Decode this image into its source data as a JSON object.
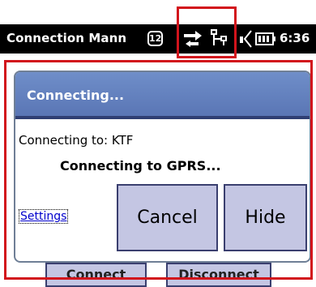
{
  "status_bar": {
    "title": "Connection Mann",
    "badge": "12",
    "clock": "6:36",
    "icons": [
      "badge-icon",
      "data-transfer-icon",
      "network-icon",
      "signal-icon",
      "battery-icon"
    ]
  },
  "dialog": {
    "title": "Connecting...",
    "connecting_to": "Connecting to: KTF",
    "status_message": "Connecting to GPRS...",
    "settings_link": "Settings",
    "cancel_label": "Cancel",
    "hide_label": "Hide"
  },
  "background": {
    "connect_label": "Connect",
    "disconnect_label": "Disconnect"
  },
  "colors": {
    "highlight": "#d2141c",
    "dialog_header": "#5a76b5",
    "button_fill": "#c4c6e3",
    "link": "#0000cc"
  }
}
